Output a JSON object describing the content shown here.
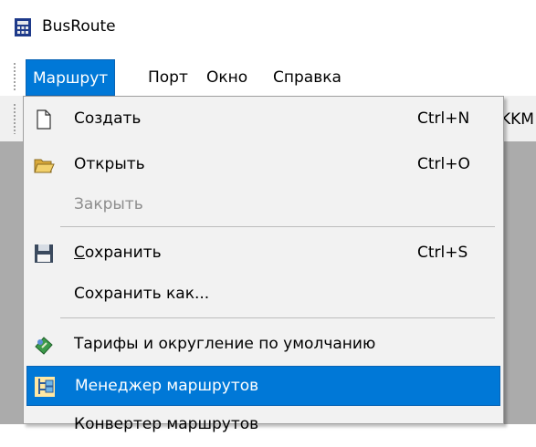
{
  "window": {
    "title": "BusRoute",
    "icon": "app-calculator-icon"
  },
  "menubar": {
    "items": [
      {
        "label": "Маршрут",
        "active": true
      },
      {
        "label": "Порт",
        "active": false
      },
      {
        "label": "Окно",
        "active": false
      },
      {
        "label": "Справка",
        "active": false
      }
    ]
  },
  "toolbar": {
    "partial_text": "KKM"
  },
  "dropdown": {
    "items": [
      {
        "label": "Создать",
        "shortcut": "Ctrl+N",
        "icon": "new-document-icon",
        "enabled": true
      },
      {
        "label": "Открыть",
        "shortcut": "Ctrl+O",
        "icon": "open-folder-icon",
        "enabled": true
      },
      {
        "label": "Закрыть",
        "shortcut": "",
        "icon": "",
        "enabled": false
      },
      {
        "label_mnemonic": "С",
        "label_rest": "охранить",
        "shortcut": "Ctrl+S",
        "icon": "floppy-disk-icon",
        "enabled": true
      },
      {
        "label": "Сохранить как...",
        "shortcut": "",
        "icon": "",
        "enabled": true
      },
      {
        "label": "Тарифы и округление по умолчанию",
        "shortcut": "",
        "icon": "tariff-icon",
        "enabled": true
      },
      {
        "label": "Менеджер маршрутов",
        "shortcut": "",
        "icon": "route-manager-icon",
        "enabled": true,
        "highlighted": true
      },
      {
        "label": "Конвертер маршрутов",
        "shortcut": "",
        "icon": "",
        "enabled": true
      }
    ]
  },
  "colors": {
    "highlight": "#0078d7",
    "menu_bg": "#f2f2f2",
    "client_bg": "#ababab",
    "disabled_text": "#8d8d8d"
  }
}
